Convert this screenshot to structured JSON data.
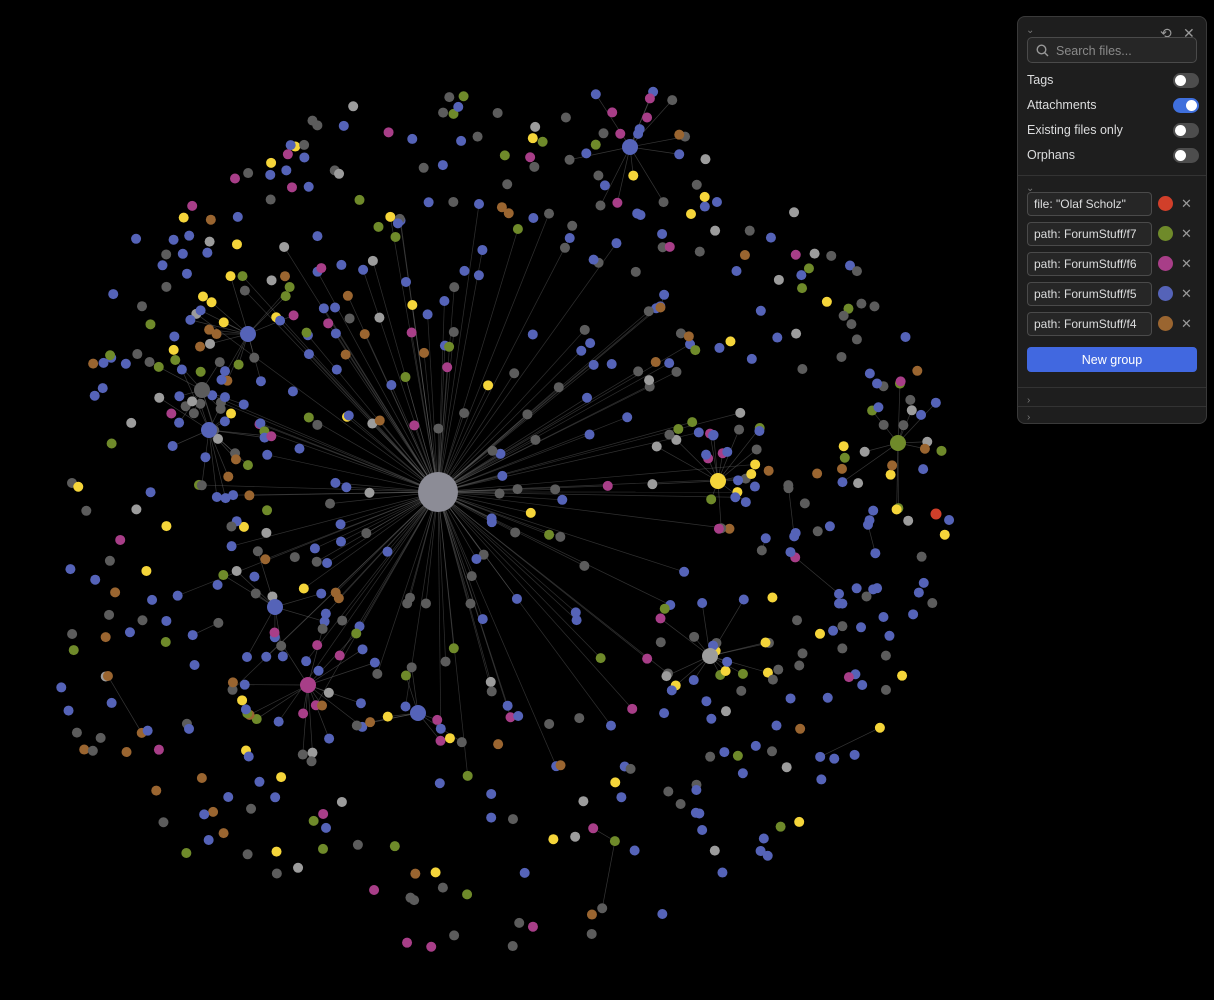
{
  "colors": {
    "background": "#000000",
    "default_node": "#5c5c5c",
    "link": "#6b6b6b",
    "hub": "#8c8c96",
    "olaf_scholz": "#d13f2a",
    "f7": "#6f8a2a",
    "f6": "#a83e88",
    "f5": "#5563b8",
    "f4": "#9a6530",
    "attachment": "#f5d53a",
    "other": "#9c9c9c"
  },
  "panel": {
    "search_placeholder": "Search files...",
    "search_value": "",
    "icons": {
      "collapse": "chevron-down-icon",
      "reset": "reset-icon",
      "close": "close-icon",
      "search": "search-icon"
    },
    "filters": [
      {
        "label": "Tags",
        "on": false
      },
      {
        "label": "Attachments",
        "on": true
      },
      {
        "label": "Existing files only",
        "on": false
      },
      {
        "label": "Orphans",
        "on": false
      }
    ],
    "groups": [
      {
        "query": "file: \"Olaf Scholz\"",
        "color": "#d13f2a"
      },
      {
        "query": "path: ForumStuff/f7",
        "color": "#6f8a2a"
      },
      {
        "query": "path: ForumStuff/f6",
        "color": "#a83e88"
      },
      {
        "query": "path: ForumStuff/f5",
        "color": "#5563b8"
      },
      {
        "query": "path: ForumStuff/f4",
        "color": "#9a6530"
      }
    ],
    "new_group_label": "New group"
  }
}
